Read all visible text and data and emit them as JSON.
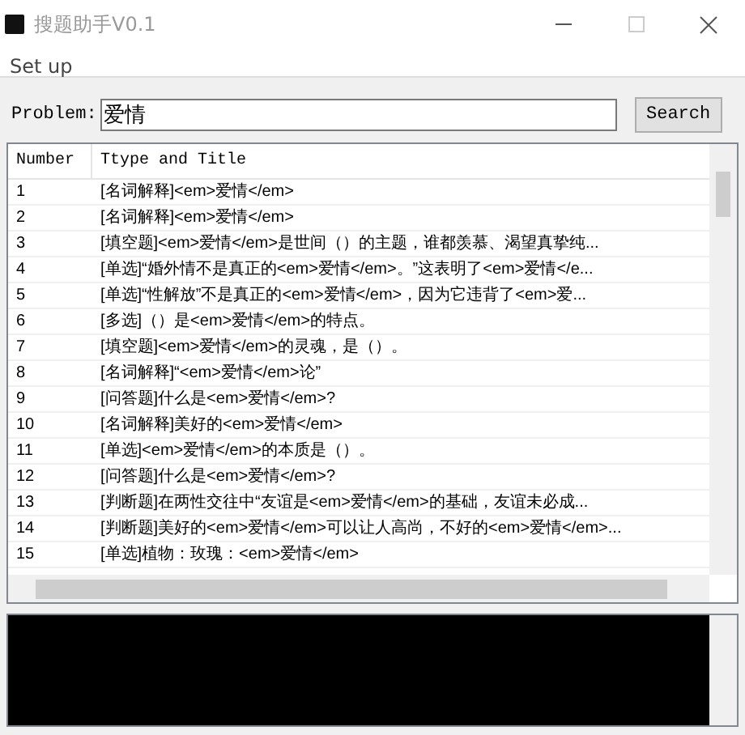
{
  "window": {
    "title": "搜题助手V0.1"
  },
  "menu": [
    "Set up"
  ],
  "search": {
    "label": "Problem:",
    "value": "爱情",
    "button": "Search"
  },
  "table": {
    "columns": [
      "Number",
      "Ttype and Title"
    ],
    "rows": [
      [
        "1",
        "[名词解释]<em>爱情</em>"
      ],
      [
        "2",
        "[名词解释]<em>爱情</em>"
      ],
      [
        "3",
        "[填空题]<em>爱情</em>是世间（）的主题，谁都羡慕、渴望真挚纯..."
      ],
      [
        "4",
        "[单选]“婚外情不是真正的<em>爱情</em>。”这表明了<em>爱情</e..."
      ],
      [
        "5",
        "[单选]“性解放”不是真正的<em>爱情</em>，因为它违背了<em>爱..."
      ],
      [
        "6",
        "[多选]（）是<em>爱情</em>的特点。"
      ],
      [
        "7",
        "[填空题]<em>爱情</em>的灵魂，是（）。"
      ],
      [
        "8",
        "[名词解释]“<em>爱情</em>论”"
      ],
      [
        "9",
        "[问答题]什么是<em>爱情</em>?"
      ],
      [
        "10",
        "[名词解释]美好的<em>爱情</em>"
      ],
      [
        "11",
        "[单选]<em>爱情</em>的本质是（）。"
      ],
      [
        "12",
        "[问答题]什么是<em>爱情</em>?"
      ],
      [
        "13",
        "[判断题]在两性交往中“友谊是<em>爱情</em>的基础，友谊未必成..."
      ],
      [
        "14",
        "[判断题]美好的<em>爱情</em>可以让人高尚，不好的<em>爱情</em>..."
      ],
      [
        "15",
        "[单选]植物：玫瑰：<em>爱情</em>"
      ]
    ]
  }
}
